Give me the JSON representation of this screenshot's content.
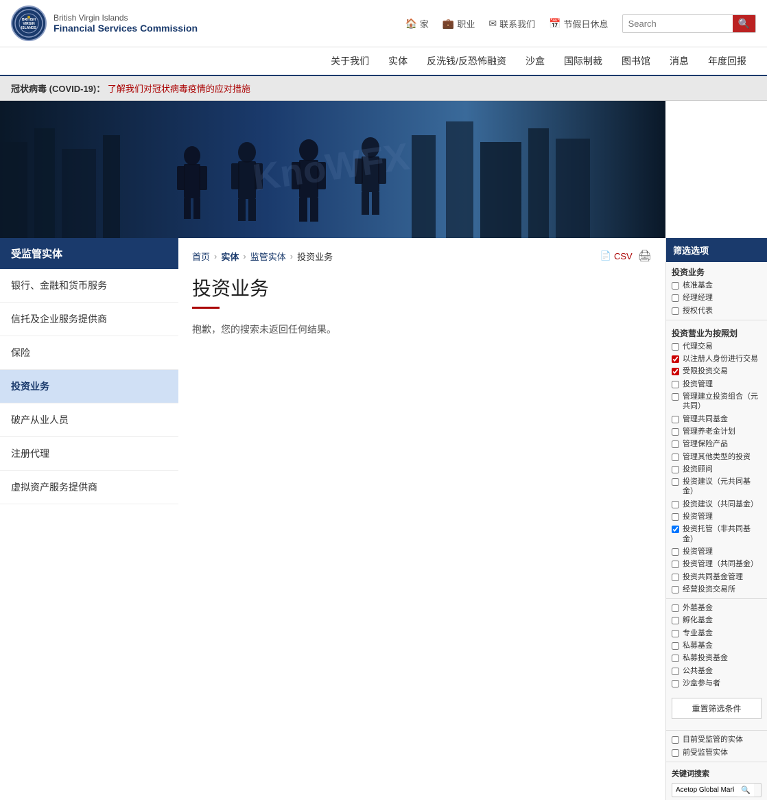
{
  "header": {
    "logo": {
      "line1": "British Virgin Islands",
      "line2": "Financial Services Commission",
      "emblem": "BVI"
    },
    "top_nav": [
      {
        "icon": "🏠",
        "label": "家",
        "id": "home"
      },
      {
        "icon": "💼",
        "label": "职业",
        "id": "career"
      },
      {
        "icon": "✉",
        "label": "联系我们",
        "id": "contact"
      },
      {
        "icon": "📅",
        "label": "节假日休息",
        "id": "holidays"
      }
    ],
    "search_placeholder": "Search",
    "main_nav": [
      {
        "label": "关于我们",
        "id": "about"
      },
      {
        "label": "实体",
        "id": "entities"
      },
      {
        "label": "反洗钱/反恐怖融资",
        "id": "aml"
      },
      {
        "label": "沙盒",
        "id": "sandbox"
      },
      {
        "label": "国际制裁",
        "id": "sanctions"
      },
      {
        "label": "图书馆",
        "id": "library"
      },
      {
        "label": "消息",
        "id": "news"
      },
      {
        "label": "年度回报",
        "id": "annual"
      }
    ]
  },
  "covid_banner": {
    "label": "冠状病毒 (COVID-19)：",
    "link_text": "了解我们对冠状病毒疫情的应对措施"
  },
  "sidebar": {
    "title": "受监管实体",
    "items": [
      {
        "label": "银行、金融和货币服务",
        "id": "banking",
        "active": false
      },
      {
        "label": "信托及企业服务提供商",
        "id": "trust",
        "active": false
      },
      {
        "label": "保险",
        "id": "insurance",
        "active": false
      },
      {
        "label": "投资业务",
        "id": "investment",
        "active": true
      },
      {
        "label": "破产从业人员",
        "id": "insolvency",
        "active": false
      },
      {
        "label": "注册代理",
        "id": "registered-agent",
        "active": false
      },
      {
        "label": "虚拟资产服务提供商",
        "id": "virtual-assets",
        "active": false
      }
    ]
  },
  "breadcrumb": {
    "home": "首页",
    "entities": "实体",
    "supervised": "监管实体",
    "current": "投资业务"
  },
  "breadcrumb_actions": {
    "csv": "CSV",
    "print": "🖨"
  },
  "main": {
    "title": "投资业务",
    "no_results": "抱歉，您的搜索未返回任何结果。"
  },
  "filter_panel": {
    "title": "筛选选项",
    "investment_section": "投资业务",
    "checkboxes_top": [
      {
        "label": "核准基金",
        "checked": false
      },
      {
        "label": "经理经理",
        "checked": false
      },
      {
        "label": "授权代表",
        "checked": false
      }
    ],
    "investment_business_sub": "投资营业为按照划",
    "checkboxes_mid": [
      {
        "label": "代理交易",
        "checked": false
      },
      {
        "label": "以注册人身份进行交易",
        "checked": true,
        "red": true
      },
      {
        "label": "受限投资交易",
        "checked": true,
        "red": true
      },
      {
        "label": "投资管理",
        "checked": false
      },
      {
        "label": "管理建立投资组合（元共同）",
        "checked": false
      },
      {
        "label": "管理共同基金",
        "checked": false
      },
      {
        "label": "管理养老金计划",
        "checked": false
      },
      {
        "label": "管理保险产品",
        "checked": false
      },
      {
        "label": "管理其他类型的投资",
        "checked": false
      },
      {
        "label": "投资顾问",
        "checked": false
      },
      {
        "label": "投资建议（元共同基金）",
        "checked": false
      },
      {
        "label": "投资建议（共同基金）",
        "checked": false
      },
      {
        "label": "投资管理",
        "checked": false
      },
      {
        "label": "投资托管（非共同基金）",
        "checked": true
      },
      {
        "label": "投资管理",
        "checked": false
      },
      {
        "label": "投资管理（共同基金）",
        "checked": false
      },
      {
        "label": "投资共同基金管理",
        "checked": false
      },
      {
        "label": "经营投资交易所",
        "checked": false
      }
    ],
    "fund_types": [
      {
        "label": "外墓基金",
        "checked": false
      },
      {
        "label": "孵化基金",
        "checked": false
      },
      {
        "label": "专业基金",
        "checked": false
      },
      {
        "label": "私募基金",
        "checked": false
      },
      {
        "label": "私募投资基金",
        "checked": false
      },
      {
        "label": "公共基金",
        "checked": false
      },
      {
        "label": "沙盒参与者",
        "checked": false
      }
    ],
    "reset_button": "重置筛选条件",
    "supervised_section": [
      {
        "label": "目前受监管的实体",
        "checked": false
      },
      {
        "label": "前受监管实体",
        "checked": false
      }
    ],
    "keyword_label": "关键词搜索",
    "keyword_value": "Acetop Global Markets Group",
    "keyword_placeholder": "Acetop Global Markets Group"
  }
}
